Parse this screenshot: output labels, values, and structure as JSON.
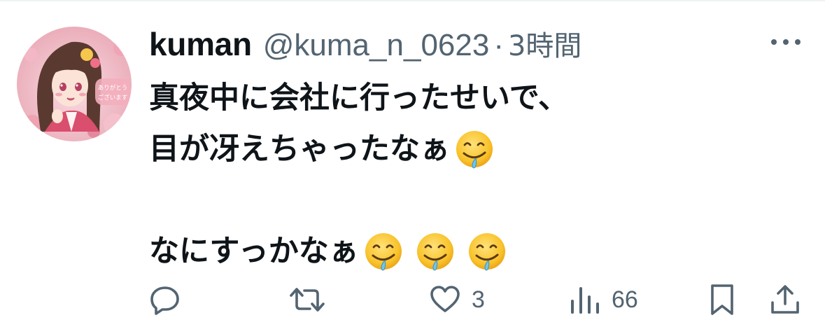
{
  "tweet": {
    "display_name": "kuman",
    "handle": "@kuma_n_0623",
    "separator": "·",
    "time_ago": "3時間",
    "avatar_caption_line1": "ありがとう",
    "avatar_caption_line2": "ございます",
    "lines": [
      "真夜中に会社に行ったせいで、",
      "目が冴えちゃったなぁ",
      "",
      "なにすっかなぁ"
    ],
    "emoji_name": "drooling-face"
  },
  "actions": {
    "reply_count": "",
    "retweet_count": "",
    "like_count": "3",
    "views_count": "66"
  },
  "colors": {
    "text": "#0f1419",
    "secondary": "#536471",
    "background": "#ffffff"
  },
  "icons": [
    "more-icon",
    "reply-icon",
    "retweet-icon",
    "like-icon",
    "views-icon",
    "bookmark-icon",
    "share-icon"
  ]
}
